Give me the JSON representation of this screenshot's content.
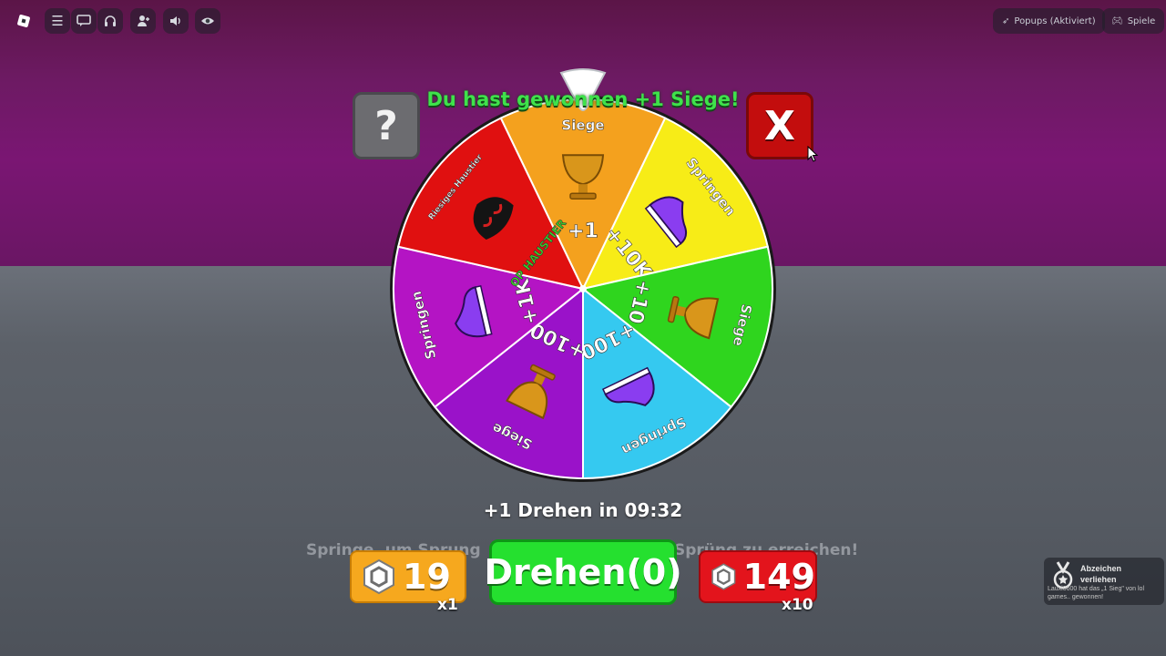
{
  "topbar": {
    "popups_label": "Popups (Aktiviert)",
    "games_label": "Spiele"
  },
  "colors": {
    "win_text": "#3fe24b",
    "spin_button": "#25e02f",
    "buy1_button": "#f6a81e",
    "buy10_button": "#e3141c",
    "close_button": "#c30d0d"
  },
  "wheel": {
    "win_message": "Du hast gewonnen +1 Siege!",
    "segments": [
      {
        "color": "#f4a11e",
        "amount": "+1",
        "reward": "Siege",
        "icon": "trophy-icon"
      },
      {
        "color": "#f7ec17",
        "amount": "+10K",
        "reward": "Springen",
        "icon": "shoe-icon"
      },
      {
        "color": "#2fd51e",
        "amount": "+10",
        "reward": "Siege",
        "icon": "trophy-icon"
      },
      {
        "color": "#35c9f0",
        "amount": "+100",
        "reward": "Springen",
        "icon": "shoe-icon"
      },
      {
        "color": "#9a12c9",
        "amount": "+100",
        "reward": "Siege",
        "icon": "trophy-icon"
      },
      {
        "color": "#b414c4",
        "amount": "+1K",
        "reward": "Springen",
        "icon": "shoe-icon"
      },
      {
        "color": "#e01010",
        "amount": "OP HAUSTIER",
        "reward": "Riesiges Haustier",
        "icon": "pet-icon"
      }
    ]
  },
  "help_button": "?",
  "close_button": "X",
  "timer_text": "+1 Drehen in 09:32",
  "hint_left": "Springe, um Sprung",
  "hint_right": "Sprüng zu erreichen!",
  "buy_one": {
    "price": "19",
    "multiplier": "x1"
  },
  "spin_button": "Drehen(0)",
  "buy_ten": {
    "price": "149",
    "multiplier": "x10"
  },
  "toast": {
    "title": "Abzeichen verliehen",
    "body": "Lauxi0600 hat das „1 Sieg\" von lol games.. gewonnen!"
  }
}
